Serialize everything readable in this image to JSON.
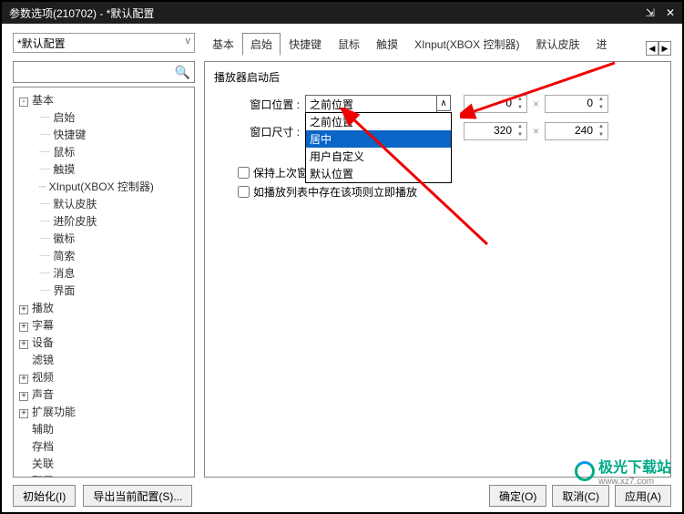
{
  "titlebar": {
    "title": "参数选项(210702) - *默认配置"
  },
  "configSelect": {
    "value": "*默认配置"
  },
  "tabs": {
    "items": [
      "基本",
      "启始",
      "快捷键",
      "鼠标",
      "触摸",
      "XInput(XBOX 控制器)",
      "默认皮肤",
      "进"
    ],
    "activeIndex": 1
  },
  "tree": {
    "root": {
      "label": "基本",
      "expanded": true
    },
    "children": [
      "启始",
      "快捷键",
      "鼠标",
      "触摸",
      "XInput(XBOX 控制器)",
      "默认皮肤",
      "进阶皮肤",
      "徽标",
      "简索",
      "消息",
      "界面"
    ],
    "collapsed": [
      "播放",
      "字幕",
      "设备",
      "滤镜",
      "视频",
      "声音",
      "扩展功能",
      "辅助",
      "存档",
      "关联",
      "配置"
    ]
  },
  "panel": {
    "groupTitle": "播放器启动后",
    "windowPosLabel": "窗口位置 :",
    "windowPosValue": "之前位置",
    "windowPosOptions": [
      "之前位置",
      "居中",
      "用户自定义",
      "默认位置"
    ],
    "windowPosSelectedIndex": 1,
    "windowSizeLabel": "窗口尺寸 :",
    "windowSizeValue": "",
    "posX": "0",
    "posY": "0",
    "sizeW": "320",
    "sizeH": "240",
    "check1": "保持上次窗口状态",
    "check2": "如播放列表中存在该项则立即播放"
  },
  "buttons": {
    "init": "初始化(I)",
    "export": "导出当前配置(S)...",
    "ok": "确定(O)",
    "cancel": "取消(C)",
    "apply": "应用(A)"
  },
  "watermark": {
    "text": "极光下载站",
    "url": "www.xz7.com"
  }
}
